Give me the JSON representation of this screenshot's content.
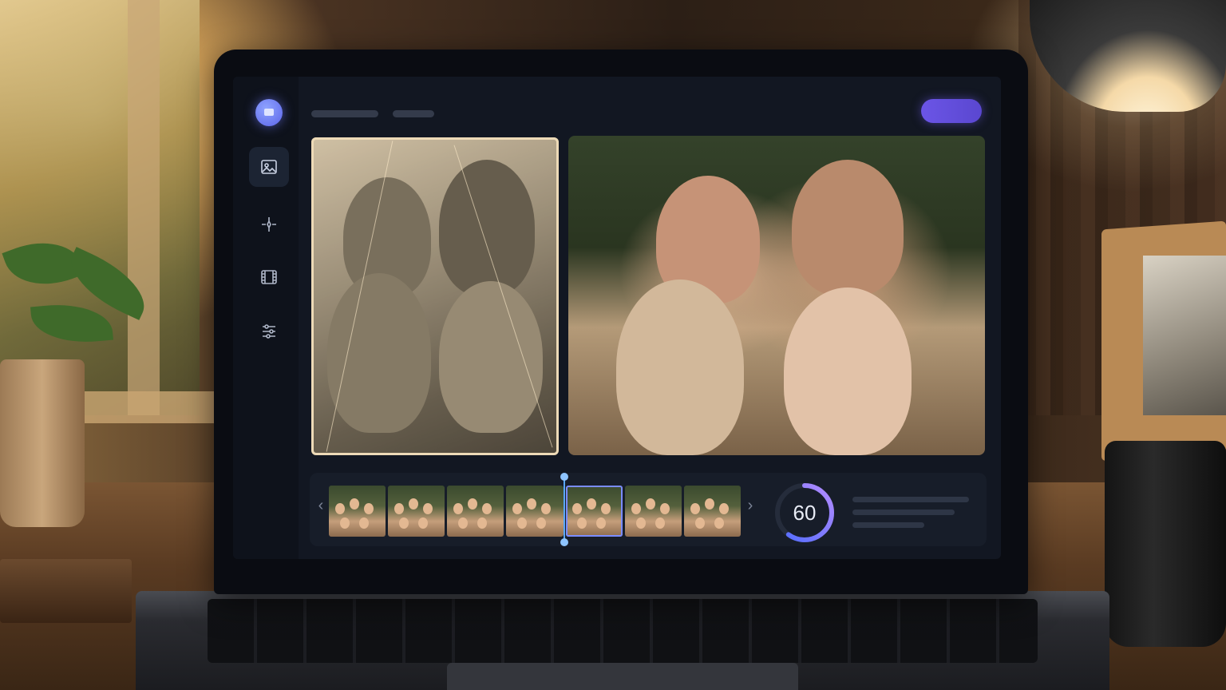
{
  "app": {
    "sidebar": {
      "items": [
        {
          "icon": "image-icon",
          "active": true
        },
        {
          "icon": "sparkle-icon",
          "active": false
        },
        {
          "icon": "film-icon",
          "active": false
        },
        {
          "icon": "sliders-icon",
          "active": false
        }
      ]
    },
    "timeline": {
      "frame_count": 7,
      "active_frame": 4,
      "playhead_position": 0.43
    },
    "progress": {
      "value": "60",
      "fraction": 0.6
    },
    "colors": {
      "accent": "#6b55e6",
      "playhead": "#58a7ff",
      "ring_start": "#4f6bff",
      "ring_end": "#b48cff"
    }
  }
}
